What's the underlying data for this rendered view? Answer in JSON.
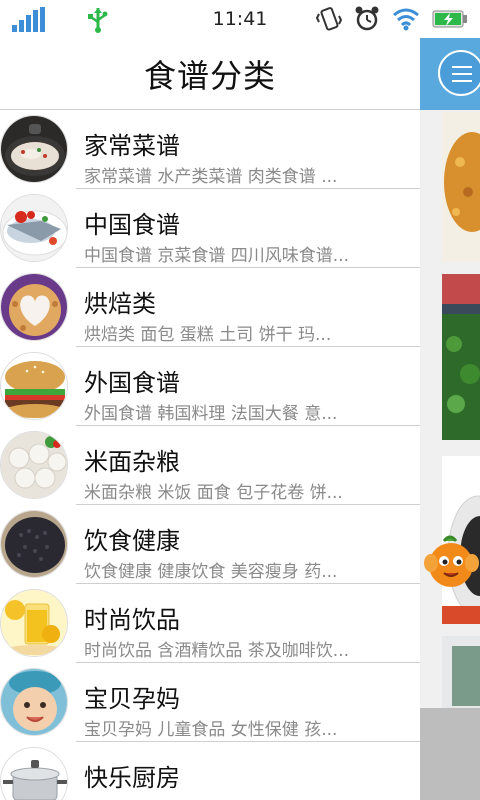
{
  "status": {
    "time": "11:41"
  },
  "header": {
    "title": "食谱分类"
  },
  "categories": [
    {
      "title": "家常菜谱",
      "subtitle": "家常菜谱  水产类菜谱  肉类食谱  ..."
    },
    {
      "title": "中国食谱",
      "subtitle": "中国食谱  京菜食谱  四川风味食谱..."
    },
    {
      "title": "烘焙类",
      "subtitle": "烘焙类  面包  蛋糕  土司  饼干  玛..."
    },
    {
      "title": "外国食谱",
      "subtitle": "外国食谱  韩国料理  法国大餐  意..."
    },
    {
      "title": "米面杂粮",
      "subtitle": "米面杂粮  米饭  面食  包子花卷  饼..."
    },
    {
      "title": "饮食健康",
      "subtitle": "饮食健康  健康饮食  美容瘦身  药..."
    },
    {
      "title": "时尚饮品",
      "subtitle": "时尚饮品  含酒精饮品  茶及咖啡饮..."
    },
    {
      "title": "宝贝孕妈",
      "subtitle": "宝贝孕妈  儿童食品  女性保健  孩..."
    },
    {
      "title": "快乐厨房",
      "subtitle": ""
    }
  ],
  "colors": {
    "accent": "#5aa9de",
    "status_green": "#2db84a",
    "signal_blue": "#3c8fd6"
  },
  "icons": {
    "signal": "signal-icon",
    "usb": "usb-icon",
    "vibrate": "vibrate-icon",
    "alarm": "alarm-icon",
    "wifi": "wifi-icon",
    "battery": "battery-icon",
    "menu": "menu-icon"
  }
}
